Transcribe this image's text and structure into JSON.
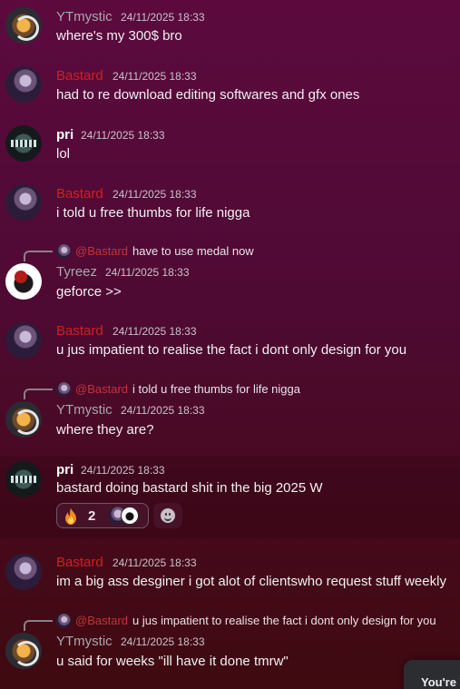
{
  "messages": [
    {
      "author": "YTmystic",
      "time": "24/11/2025 18:33",
      "text": "where's my 300$ bro"
    },
    {
      "author": "Bastard",
      "time": "24/11/2025 18:33",
      "text": "had to re download editing softwares and gfx ones"
    },
    {
      "author": "pri",
      "time": "24/11/2025 18:33",
      "text": "lol"
    },
    {
      "author": "Bastard",
      "time": "24/11/2025 18:33",
      "text": "i told u free thumbs for life nigga"
    },
    {
      "author": "Tyreez",
      "time": "24/11/2025 18:33",
      "text": "geforce >>",
      "reply": {
        "mention": "@Bastard",
        "text": "have to use medal now"
      }
    },
    {
      "author": "Bastard",
      "time": "24/11/2025 18:33",
      "text": "u jus impatient to realise the fact i dont only design for you"
    },
    {
      "author": "YTmystic",
      "time": "24/11/2025 18:33",
      "text": "where they are?",
      "reply": {
        "mention": "@Bastard",
        "text": "i told u free thumbs for life nigga"
      }
    },
    {
      "author": "pri",
      "time": "24/11/2025 18:33",
      "text": "bastard doing bastard shit in the big 2025 W",
      "reaction": {
        "emoji": "fire-icon",
        "count": "2"
      }
    },
    {
      "author": "Bastard",
      "time": "24/11/2025 18:33",
      "text": "im a big ass desginer i got alot of clientswho request stuff weekly"
    },
    {
      "author": "YTmystic",
      "time": "24/11/2025 18:33",
      "text": "u said for weeks \"ill have it done tmrw\"",
      "reply": {
        "mention": "@Bastard",
        "text": "u jus impatient to realise the fact i dont only design for you"
      }
    }
  ],
  "toast": {
    "text": "You're V"
  },
  "colors": {
    "bastard": "#d41f1f",
    "mention": "#c3343a",
    "muted_name": "#a6a9ad"
  }
}
